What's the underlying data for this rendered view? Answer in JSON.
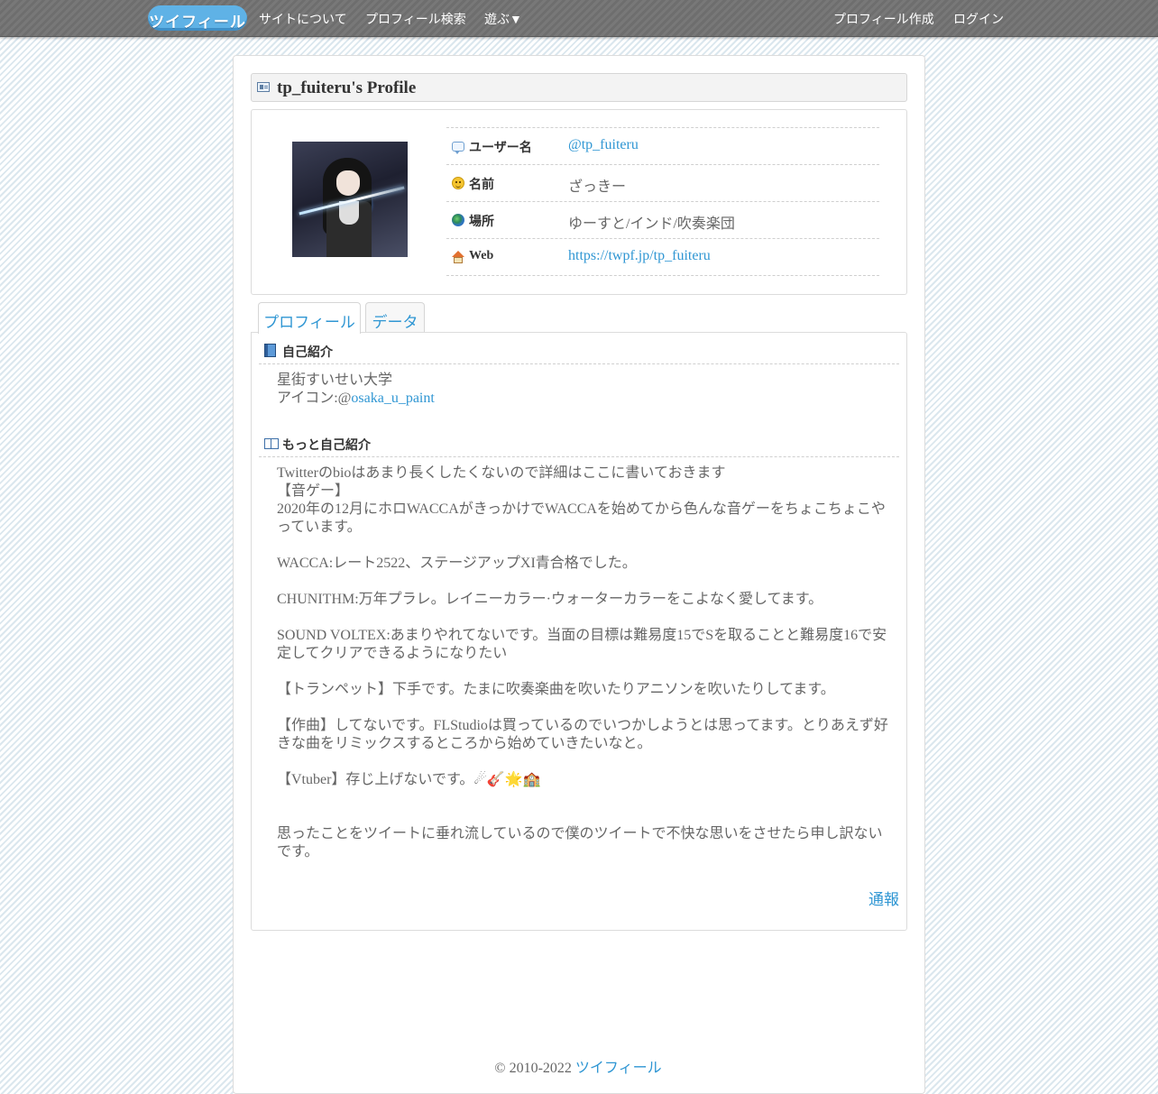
{
  "nav": {
    "logo": "ツイフィール",
    "links": [
      "サイトについて",
      "プロフィール検索",
      "遊ぶ▼"
    ],
    "right_links": [
      "プロフィール作成",
      "ログイン"
    ]
  },
  "profile": {
    "title": "tp_fuiteru's Profile",
    "rows": [
      {
        "label": "ユーザー名",
        "value": "@tp_fuiteru"
      },
      {
        "label": "名前",
        "value": "ざっきー"
      },
      {
        "label": "場所",
        "value": "ゆーすと/インド/吹奏楽団"
      },
      {
        "label": "Web",
        "value": "https://twpf.jp/tp_fuiteru"
      }
    ]
  },
  "tabs": [
    "プロフィール",
    "データ"
  ],
  "intro": {
    "title": "自己紹介",
    "line1": "星街すいせい大学",
    "line2_prefix": "アイコン:@",
    "line2_link": "osaka_u_paint"
  },
  "more": {
    "title": "もっと自己紹介",
    "text": "Twitterのbioはあまり長くしたくないので詳細はここに書いておきます\n【音ゲー】\n2020年の12月にホロWACCAがきっかけでWACCAを始めてから色んな音ゲーをちょこちょこやっています。\n\nWACCA:レート2522、ステージアップXI青合格でした。\n\nCHUNITHM:万年プラレ。レイニーカラー·ウォーターカラーをこよなく愛してます。\n\nSOUND VOLTEX:あまりやれてないです。当面の目標は難易度15でSを取ることと難易度16で安定してクリアできるようになりたい\n\n【トランペット】下手です。たまに吹奏楽曲を吹いたりアニソンを吹いたりしてます。\n\n【作曲】してないです。FLStudioは買っているのでいつかしようとは思ってます。とりあえず好きな曲をリミックスするところから始めていきたいなと。\n\n【Vtuber】存じ上げないです。☄🎸🌟🏫\n\n\n思ったことをツイートに垂れ流しているので僕のツイートで不快な思いをさせたら申し訳ないです。"
  },
  "report": "通報",
  "footer": {
    "copyright": "© 2010-2022 ",
    "site": "ツイフィール"
  }
}
